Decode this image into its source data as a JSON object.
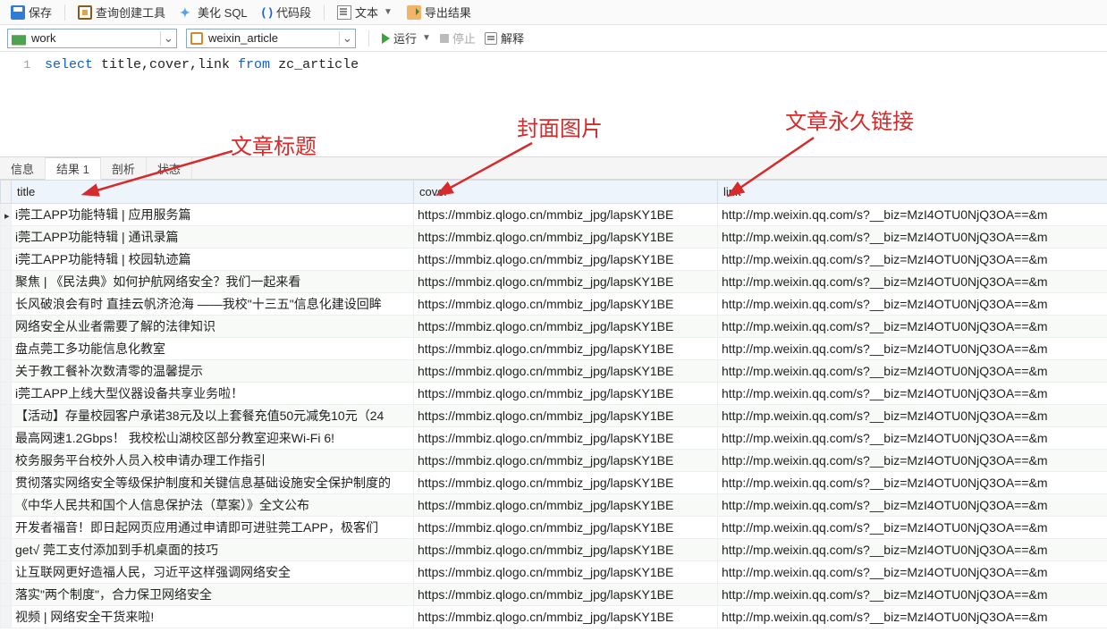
{
  "toolbar": {
    "save": "保存",
    "queryBuilder": "查询创建工具",
    "beautify": "美化 SQL",
    "snippet": "代码段",
    "text": "文本",
    "export": "导出结果"
  },
  "combos": {
    "database": "work",
    "table": "weixin_article"
  },
  "run": {
    "run": "运行",
    "stop": "停止",
    "explain": "解释"
  },
  "editor": {
    "lineNo": "1",
    "sql_select": "select",
    "sql_cols": " title,cover,link ",
    "sql_from": "from",
    "sql_table": " zc_article"
  },
  "annotations": {
    "a1": "文章标题",
    "a2": "封面图片",
    "a3": "文章永久链接"
  },
  "tabs": {
    "info": "信息",
    "result": "结果 1",
    "profile": "剖析",
    "status": "状态"
  },
  "columns": {
    "title": "title",
    "cover": "cover",
    "link": "link"
  },
  "rows": [
    {
      "title": "i莞工APP功能特辑 | 应用服务篇",
      "cover": "https://mmbiz.qlogo.cn/mmbiz_jpg/lapsKY1BE",
      "link": "http://mp.weixin.qq.com/s?__biz=MzI4OTU0NjQ3OA==&m"
    },
    {
      "title": "i莞工APP功能特辑 | 通讯录篇",
      "cover": "https://mmbiz.qlogo.cn/mmbiz_jpg/lapsKY1BE",
      "link": "http://mp.weixin.qq.com/s?__biz=MzI4OTU0NjQ3OA==&m"
    },
    {
      "title": "i莞工APP功能特辑 | 校园轨迹篇",
      "cover": "https://mmbiz.qlogo.cn/mmbiz_jpg/lapsKY1BE",
      "link": "http://mp.weixin.qq.com/s?__biz=MzI4OTU0NjQ3OA==&m"
    },
    {
      "title": "聚焦 | 《民法典》如何护航网络安全？我们一起来看",
      "cover": "https://mmbiz.qlogo.cn/mmbiz_jpg/lapsKY1BE",
      "link": "http://mp.weixin.qq.com/s?__biz=MzI4OTU0NjQ3OA==&m"
    },
    {
      "title": "长风破浪会有时 直挂云帆济沧海 ——我校\"十三五\"信息化建设回眸",
      "cover": "https://mmbiz.qlogo.cn/mmbiz_jpg/lapsKY1BE",
      "link": "http://mp.weixin.qq.com/s?__biz=MzI4OTU0NjQ3OA==&m"
    },
    {
      "title": "网络安全从业者需要了解的法律知识",
      "cover": "https://mmbiz.qlogo.cn/mmbiz_jpg/lapsKY1BE",
      "link": "http://mp.weixin.qq.com/s?__biz=MzI4OTU0NjQ3OA==&m"
    },
    {
      "title": "盘点莞工多功能信息化教室",
      "cover": "https://mmbiz.qlogo.cn/mmbiz_jpg/lapsKY1BE",
      "link": "http://mp.weixin.qq.com/s?__biz=MzI4OTU0NjQ3OA==&m"
    },
    {
      "title": "关于教工餐补次数清零的温馨提示",
      "cover": "https://mmbiz.qlogo.cn/mmbiz_jpg/lapsKY1BE",
      "link": "http://mp.weixin.qq.com/s?__biz=MzI4OTU0NjQ3OA==&m"
    },
    {
      "title": "i莞工APP上线大型仪器设备共享业务啦！",
      "cover": "https://mmbiz.qlogo.cn/mmbiz_jpg/lapsKY1BE",
      "link": "http://mp.weixin.qq.com/s?__biz=MzI4OTU0NjQ3OA==&m"
    },
    {
      "title": "【活动】存量校园客户承诺38元及以上套餐充值50元减免10元（24",
      "cover": "https://mmbiz.qlogo.cn/mmbiz_jpg/lapsKY1BE",
      "link": "http://mp.weixin.qq.com/s?__biz=MzI4OTU0NjQ3OA==&m"
    },
    {
      "title": "最高网速1.2Gbps！ 我校松山湖校区部分教室迎来Wi-Fi 6!",
      "cover": "https://mmbiz.qlogo.cn/mmbiz_jpg/lapsKY1BE",
      "link": "http://mp.weixin.qq.com/s?__biz=MzI4OTU0NjQ3OA==&m"
    },
    {
      "title": "校务服务平台校外人员入校申请办理工作指引",
      "cover": "https://mmbiz.qlogo.cn/mmbiz_jpg/lapsKY1BE",
      "link": "http://mp.weixin.qq.com/s?__biz=MzI4OTU0NjQ3OA==&m"
    },
    {
      "title": "贯彻落实网络安全等级保护制度和关键信息基础设施安全保护制度的",
      "cover": "https://mmbiz.qlogo.cn/mmbiz_jpg/lapsKY1BE",
      "link": "http://mp.weixin.qq.com/s?__biz=MzI4OTU0NjQ3OA==&m"
    },
    {
      "title": "《中华人民共和国个人信息保护法（草案）》全文公布",
      "cover": "https://mmbiz.qlogo.cn/mmbiz_jpg/lapsKY1BE",
      "link": "http://mp.weixin.qq.com/s?__biz=MzI4OTU0NjQ3OA==&m"
    },
    {
      "title": "开发者福音！即日起网页应用通过申请即可进驻莞工APP，极客们",
      "cover": "https://mmbiz.qlogo.cn/mmbiz_jpg/lapsKY1BE",
      "link": "http://mp.weixin.qq.com/s?__biz=MzI4OTU0NjQ3OA==&m"
    },
    {
      "title": "get√ 莞工支付添加到手机桌面的技巧",
      "cover": "https://mmbiz.qlogo.cn/mmbiz_jpg/lapsKY1BE",
      "link": "http://mp.weixin.qq.com/s?__biz=MzI4OTU0NjQ3OA==&m"
    },
    {
      "title": "让互联网更好造福人民，习近平这样强调网络安全",
      "cover": "https://mmbiz.qlogo.cn/mmbiz_jpg/lapsKY1BE",
      "link": "http://mp.weixin.qq.com/s?__biz=MzI4OTU0NjQ3OA==&m"
    },
    {
      "title": "落实\"两个制度\"，合力保卫网络安全",
      "cover": "https://mmbiz.qlogo.cn/mmbiz_jpg/lapsKY1BE",
      "link": "http://mp.weixin.qq.com/s?__biz=MzI4OTU0NjQ3OA==&m"
    },
    {
      "title": "视频 | 网络安全干货来啦!",
      "cover": "https://mmbiz.qlogo.cn/mmbiz_jpg/lapsKY1BE",
      "link": "http://mp.weixin.qq.com/s?__biz=MzI4OTU0NjQ3OA==&m"
    }
  ]
}
